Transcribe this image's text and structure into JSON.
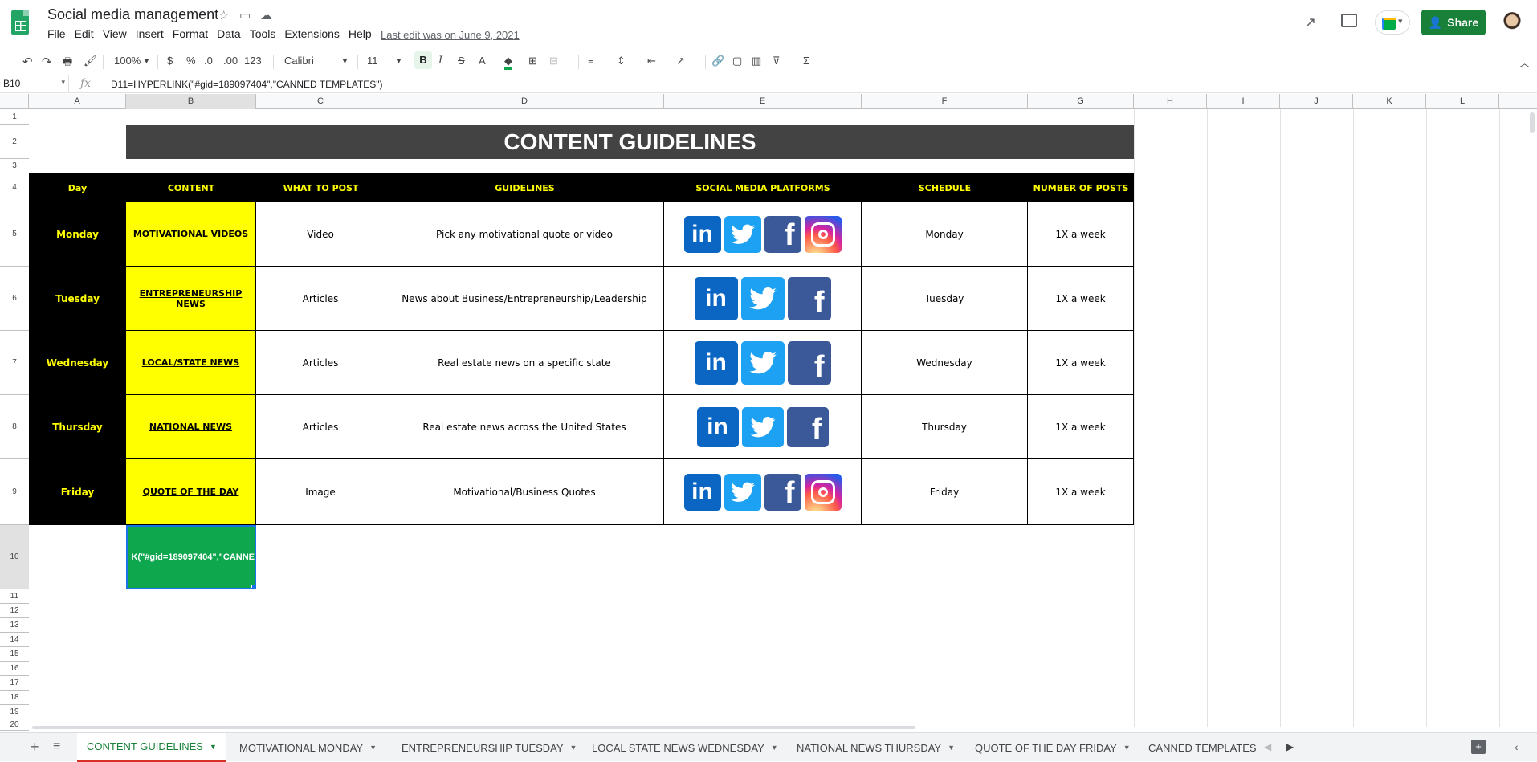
{
  "app": {
    "title": "Social media management",
    "menu": [
      "File",
      "Edit",
      "View",
      "Insert",
      "Format",
      "Data",
      "Tools",
      "Extensions",
      "Help"
    ],
    "last_edit": "Last edit was on June 9, 2021",
    "share_label": "Share"
  },
  "toolbar": {
    "zoom": "100%",
    "currency": "$",
    "percent": "%",
    "dec_less": ".0",
    "dec_more": ".00",
    "format_more": "123",
    "font": "Calibri",
    "font_size": "11"
  },
  "formula_bar": {
    "cell_ref": "B10",
    "formula": "D11=HYPERLINK(\"#gid=189097404\",\"CANNED TEMPLATES\")"
  },
  "columns": [
    "A",
    "B",
    "C",
    "D",
    "E",
    "F",
    "G",
    "H",
    "I",
    "J",
    "K",
    "L"
  ],
  "rows": [
    "1",
    "2",
    "3",
    "4",
    "5",
    "6",
    "7",
    "8",
    "9",
    "10",
    "11",
    "12",
    "13",
    "14",
    "15",
    "16",
    "17",
    "18",
    "19",
    "20"
  ],
  "sheet": {
    "title": "CONTENT GUIDELINES",
    "headers": [
      "Day",
      "CONTENT",
      "WHAT TO POST",
      "GUIDELINES",
      "SOCIAL MEDIA PLATFORMS",
      "SCHEDULE",
      "NUMBER OF POSTS"
    ],
    "rows": [
      {
        "day": "Monday",
        "content": "MOTIVATIONAL VIDEOS",
        "what": "Video",
        "guidelines": "Pick any motivational quote or video",
        "platforms": [
          "linkedin",
          "twitter",
          "facebook",
          "instagram"
        ],
        "schedule": "Monday",
        "posts": "1X a week"
      },
      {
        "day": "Tuesday",
        "content": "ENTREPRENEURSHIP NEWS",
        "what": "Articles",
        "guidelines": "News about Business/Entrepreneurship/Leadership",
        "platforms": [
          "linkedin",
          "twitter",
          "facebook"
        ],
        "schedule": "Tuesday",
        "posts": "1X a week"
      },
      {
        "day": "Wednesday",
        "content": "LOCAL/STATE NEWS",
        "what": "Articles",
        "guidelines": "Real estate news on a specific state",
        "platforms": [
          "linkedin",
          "twitter",
          "facebook"
        ],
        "schedule": "Wednesday",
        "posts": "1X a week"
      },
      {
        "day": "Thursday",
        "content": "NATIONAL NEWS",
        "what": "Articles",
        "guidelines": "Real estate news across the United States",
        "platforms": [
          "linkedin",
          "twitter",
          "facebook"
        ],
        "schedule": "Thursday",
        "posts": "1X a week"
      },
      {
        "day": "Friday",
        "content": "QUOTE OF THE DAY",
        "what": "Image",
        "guidelines": "Motivational/Business Quotes",
        "platforms": [
          "linkedin",
          "twitter",
          "facebook",
          "instagram"
        ],
        "schedule": "Friday",
        "posts": "1X a week"
      }
    ],
    "b10_text": "K(\"#gid=189097404\",\"CANNE"
  },
  "icons": {
    "linkedin": "in",
    "facebook": "f"
  },
  "tabs": [
    "CONTENT GUIDELINES",
    "MOTIVATIONAL MONDAY",
    "ENTREPRENEURSHIP TUESDAY",
    "LOCAL STATE NEWS WEDNESDAY",
    "NATIONAL NEWS THURSDAY",
    "QUOTE OF THE DAY FRIDAY",
    "CANNED TEMPLATES"
  ],
  "colors": {
    "active_tab": "#188038",
    "share": "#188038",
    "header_text": "#ffff00",
    "content_bg": "#ffff00",
    "selected_cell": "#0ea74e"
  }
}
